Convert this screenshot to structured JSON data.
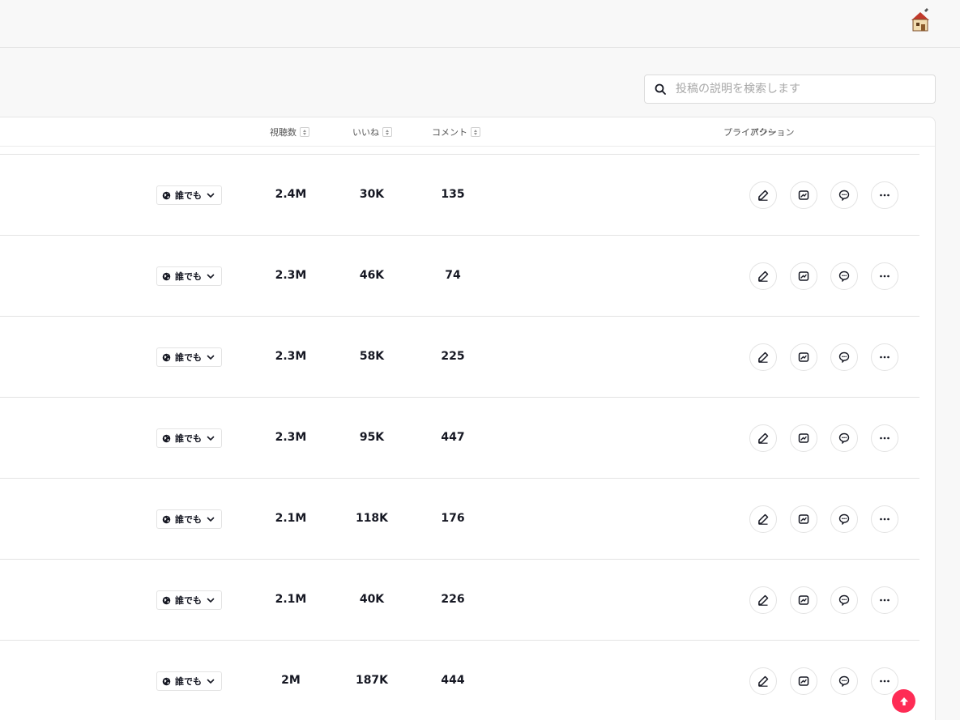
{
  "search": {
    "placeholder": "投稿の説明を検索します"
  },
  "table": {
    "headers": {
      "privacy": "プライバシー",
      "views": "視聴数",
      "likes": "いいね",
      "comments": "コメント",
      "actions": "アクション"
    },
    "rows": [
      {
        "privacy": "誰でも",
        "views": "2.4M",
        "likes": "30K",
        "comments": "135"
      },
      {
        "privacy": "誰でも",
        "views": "2.3M",
        "likes": "46K",
        "comments": "74"
      },
      {
        "privacy": "誰でも",
        "views": "2.3M",
        "likes": "58K",
        "comments": "225"
      },
      {
        "privacy": "誰でも",
        "views": "2.3M",
        "likes": "95K",
        "comments": "447"
      },
      {
        "privacy": "誰でも",
        "views": "2.1M",
        "likes": "118K",
        "comments": "176"
      },
      {
        "privacy": "誰でも",
        "views": "2.1M",
        "likes": "40K",
        "comments": "226"
      },
      {
        "privacy": "誰でも",
        "views": "2M",
        "likes": "187K",
        "comments": "444"
      }
    ]
  },
  "colors": {
    "accent": "#fe2c55",
    "text": "#161823"
  },
  "icons": {
    "search": "search-icon",
    "privacy": "globe-icon",
    "dropdown": "chevron-down-icon",
    "edit": "pencil-icon",
    "analytics": "analytics-icon",
    "comments": "comment-bubble-icon",
    "more": "more-dots-icon",
    "scroll_top": "arrow-up-icon"
  }
}
